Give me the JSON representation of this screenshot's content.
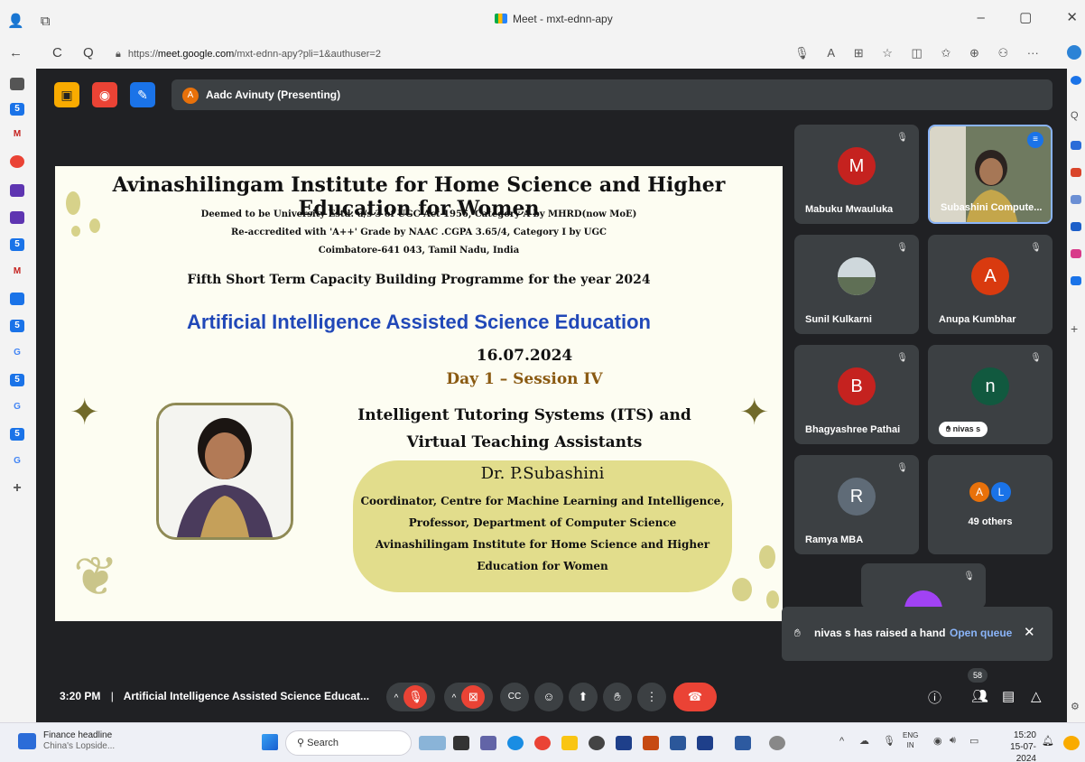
{
  "browser": {
    "tab_title": "Meet - mxt-ednn-apy",
    "url_prefix": "https://",
    "url_host": "meet.google.com",
    "url_path": "/mxt-ednn-apy?pli=1&authuser=2",
    "icons": {
      "back": "←",
      "reload": "C",
      "search": "Q",
      "minimize": "–",
      "restore": "▢",
      "close": "✕"
    }
  },
  "meet": {
    "presenting_initial": "A",
    "presenting_label": "Aadc Avinuty (Presenting)",
    "time": "3:20 PM",
    "separator": "|",
    "meeting_title": "Artificial Intelligence Assisted Science Educat...",
    "participant_count": "58",
    "participants": [
      {
        "initial": "M",
        "name": "Mabuku Mwauluka",
        "color": "#c5221f"
      },
      {
        "initial": "",
        "name": "Subashini Compute...",
        "color": "#5e6b4c"
      },
      {
        "initial": "",
        "name": "Sunil Kulkarni",
        "color": "#6f7a7a"
      },
      {
        "initial": "A",
        "name": "Anupa Kumbhar",
        "color": "#d93a0f"
      },
      {
        "initial": "B",
        "name": "Bhagyashree Pathai",
        "color": "#c5221f"
      },
      {
        "initial": "n",
        "name": "nivas s",
        "color": "#11593f"
      },
      {
        "initial": "R",
        "name": "Ramya MBA",
        "color": "#5f6b77"
      },
      {
        "initial": "",
        "name": "49 others",
        "color": "#3c4043"
      }
    ],
    "others_initials": [
      "A",
      "L"
    ],
    "toast": {
      "message": "nivas s has raised a hand",
      "action": "Open queue",
      "close": "✕"
    }
  },
  "slide": {
    "title": "Avinashilingam Institute for Home Science and Higher Education for Women",
    "line1": "Deemed to be University Estd. u/s 3 of UGC Act 1956, Category A by MHRD(now MoE)",
    "line2": "Re-accredited with 'A++' Grade by NAAC  .CGPA 3.65/4, Category I by UGC",
    "line3": "Coimbatore-641 043, Tamil Nadu, India",
    "programme": "Fifth Short Term Capacity Building Programme for the year 2024",
    "main_title": "Artificial Intelligence Assisted Science Education",
    "date": "16.07.2024",
    "session": "Day 1 – Session IV",
    "topic_line1": "Intelligent Tutoring Systems (ITS) and",
    "topic_line2": "Virtual Teaching Assistants",
    "speaker": "Dr. P.Subashini",
    "role1": "Coordinator, Centre for Machine Learning and Intelligence,",
    "role2": "Professor, Department of Computer Science",
    "role3": "Avinashilingam Institute for Home Science and Higher",
    "role4": "Education for Women"
  },
  "taskbar": {
    "news_title": "Finance headline",
    "news_sub": "China's Lopside...",
    "search_placeholder": "Search",
    "lang1": "ENG",
    "lang2": "IN",
    "clock_time": "15:20",
    "clock_date": "15-07-2024"
  },
  "colors": {
    "meet_bg": "#202124",
    "tile_bg": "#3c4043",
    "end_call": "#ea4335",
    "slide_blue": "#2148b8",
    "session_brown": "#8a5a12",
    "link_blue": "#8ab4f8"
  }
}
